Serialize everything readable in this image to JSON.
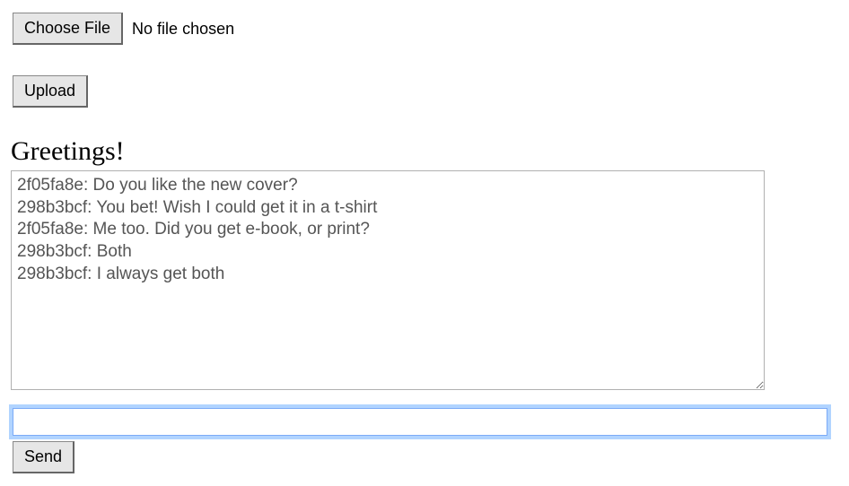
{
  "file_picker": {
    "button_label": "Choose File",
    "status_text": "No file chosen"
  },
  "upload": {
    "button_label": "Upload"
  },
  "heading": "Greetings!",
  "chat": {
    "log": "2f05fa8e: Do you like the new cover?\n298b3bcf: You bet! Wish I could get it in a t-shirt\n2f05fa8e: Me too. Did you get e-book, or print?\n298b3bcf: Both\n298b3bcf: I always get both",
    "input_value": "",
    "send_label": "Send"
  }
}
